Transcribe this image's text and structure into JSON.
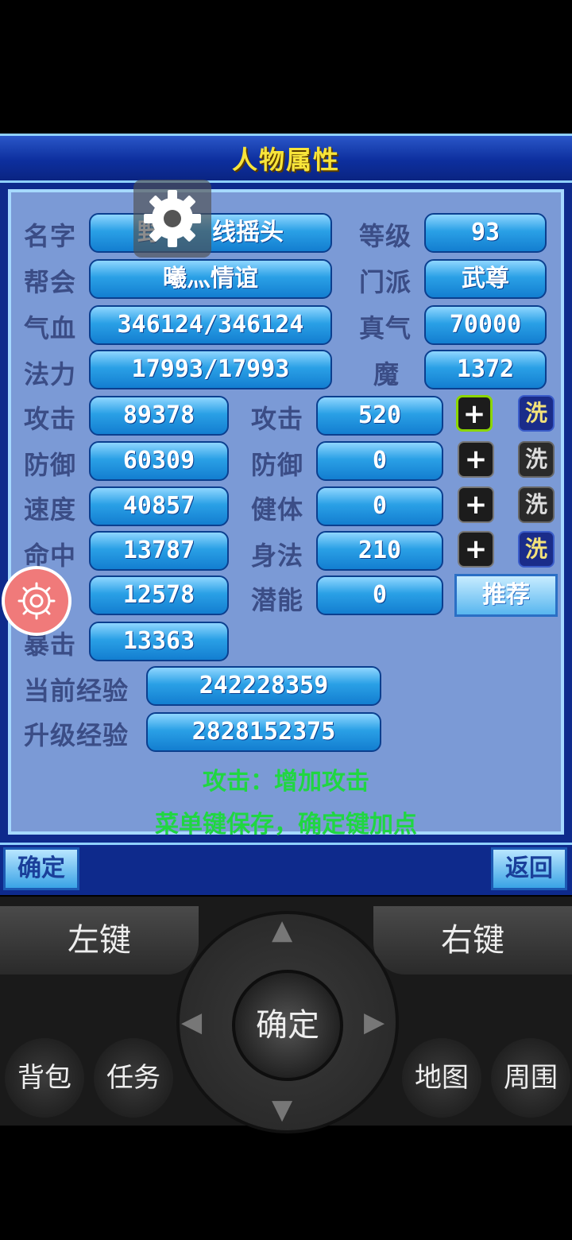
{
  "title": "人物属性",
  "rows_top": [
    {
      "label": "名字",
      "value": "野",
      "value_rest": "线摇头",
      "label2": "等级",
      "value2": "93"
    },
    {
      "label": "帮会",
      "value": "曦灬情谊",
      "label2": "门派",
      "value2": "武尊"
    },
    {
      "label": "气血",
      "value": "346124/346124",
      "label2": "真气",
      "value2": "70000"
    },
    {
      "label": "法力",
      "value": "17993/17993",
      "label2": "魔",
      "value2": "1372"
    }
  ],
  "rows_attr": [
    {
      "label": "攻击",
      "value": "89378",
      "label2": "攻击",
      "value2": "520",
      "plus": "+",
      "wash": "洗"
    },
    {
      "label": "防御",
      "value": "60309",
      "label2": "防御",
      "value2": "0",
      "plus": "+",
      "wash": "洗"
    },
    {
      "label": "速度",
      "value": "40857",
      "label2": "健体",
      "value2": "0",
      "plus": "+",
      "wash": "洗"
    },
    {
      "label": "命中",
      "value": "13787",
      "label2": "身法",
      "value2": "210",
      "plus": "+",
      "wash": "洗"
    },
    {
      "label": "",
      "value": "12578",
      "label2": "潜能",
      "value2": "0"
    },
    {
      "label": "暴击",
      "value": "13363"
    }
  ],
  "recommend": "推荐",
  "exp": [
    {
      "label": "当前经验",
      "value": "242228359"
    },
    {
      "label": "升级经验",
      "value": "2828152375"
    }
  ],
  "hint1": "攻击：增加攻击",
  "hint2": "菜单键保存，确定键加点",
  "bottom": {
    "confirm": "确定",
    "back": "返回"
  },
  "controller": {
    "left_key": "左键",
    "right_key": "右键",
    "center": "确定",
    "bag": "背包",
    "task": "任务",
    "map": "地图",
    "around": "周围"
  },
  "colors": {
    "title": "#f7e43a",
    "hint": "#20d642",
    "panel": "#7b9ad6"
  }
}
